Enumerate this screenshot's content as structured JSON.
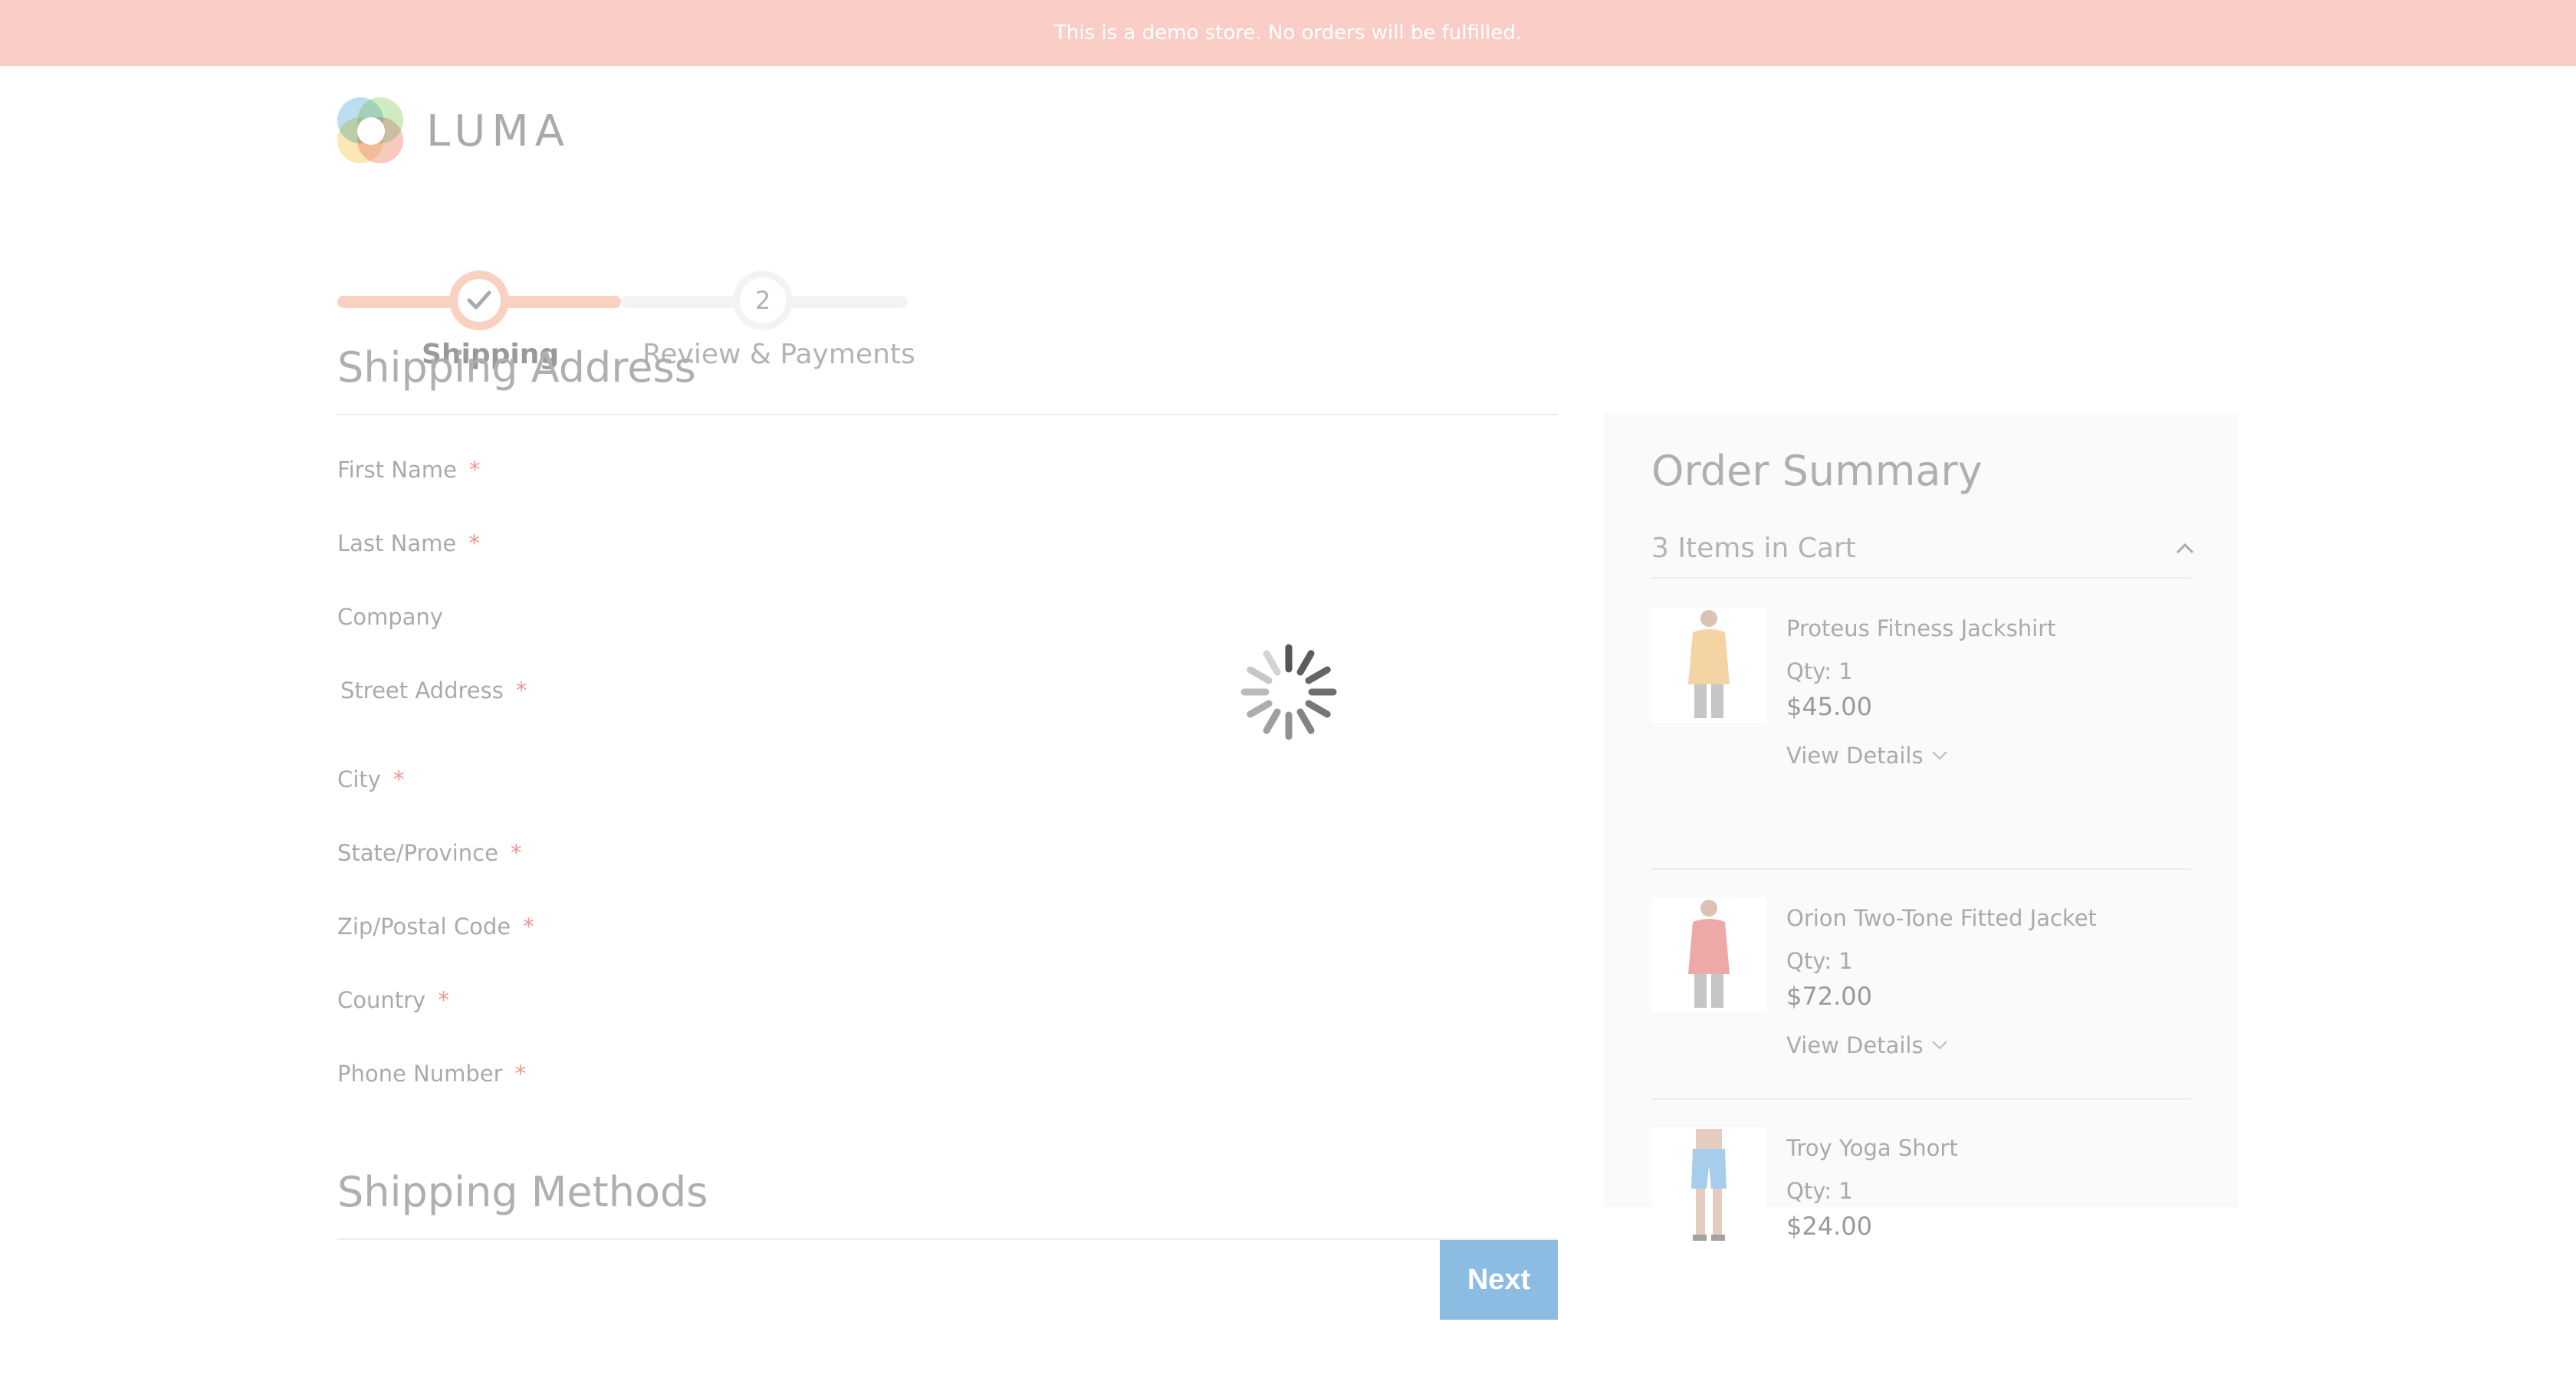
{
  "banner": {
    "text": "This is a demo store. No orders will be fulfilled."
  },
  "logo": {
    "text": "LUMA"
  },
  "progress": {
    "steps": [
      {
        "label": "Shipping",
        "state": "complete"
      },
      {
        "label": "Review & Payments",
        "number": "2",
        "state": "pending"
      }
    ]
  },
  "shipping": {
    "title": "Shipping Address",
    "fields": [
      {
        "label": "First Name",
        "required": "*"
      },
      {
        "label": "Last Name",
        "required": "*"
      },
      {
        "label": "Company"
      },
      {
        "label": "Street Address",
        "required": "*"
      },
      {
        "label": "City",
        "required": "*"
      },
      {
        "label": "State/Province",
        "required": "*"
      },
      {
        "label": "Zip/Postal Code",
        "required": "*"
      },
      {
        "label": "Country",
        "required": "*"
      },
      {
        "label": "Phone Number",
        "required": "*"
      }
    ],
    "methods_title": "Shipping Methods",
    "next_label": "Next"
  },
  "summary": {
    "title": "Order Summary",
    "cart_count": "3 Items in Cart",
    "items": [
      {
        "name": "Proteus Fitness Jackshirt",
        "qty": "Qty: 1",
        "price": "$45.00",
        "details": "View Details",
        "color": "#e9a94b"
      },
      {
        "name": "Orion Two-Tone Fitted Jacket",
        "qty": "Qty: 1",
        "price": "$72.00",
        "details": "View Details",
        "color": "#d9534f"
      },
      {
        "name": "Troy Yoga Short",
        "qty": "Qty: 1",
        "price": "$24.00",
        "color": "#4f9ad6"
      }
    ]
  },
  "colors": {
    "accent": "#f3a381",
    "button": "#1979c3",
    "required": "#e02b27",
    "banner": "#f49b8f"
  }
}
